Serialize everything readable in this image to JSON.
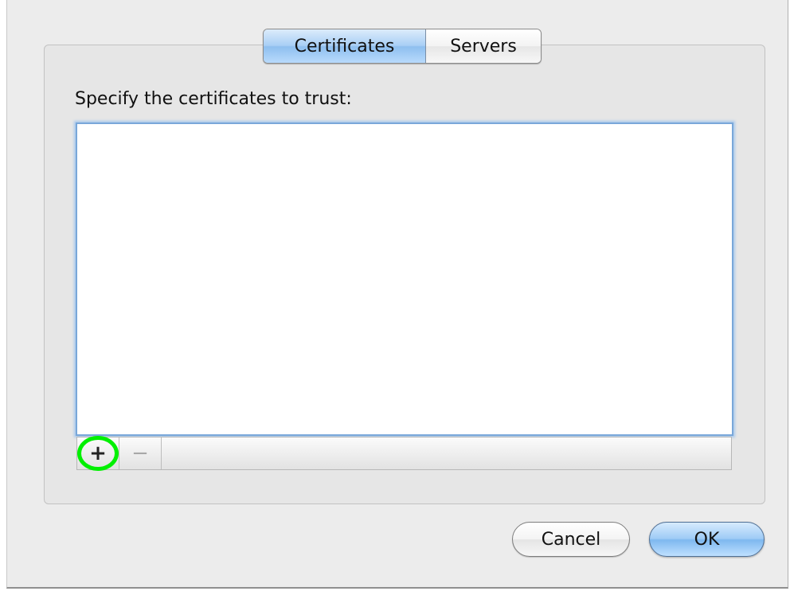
{
  "tabs": [
    {
      "label": "Certificates",
      "selected": true
    },
    {
      "label": "Servers",
      "selected": false
    }
  ],
  "main": {
    "instruction": "Specify the certificates to trust:",
    "list_items": []
  },
  "list_footer": {
    "add_label": "+",
    "remove_label": "−"
  },
  "buttons": {
    "cancel_label": "Cancel",
    "ok_label": "OK"
  },
  "colors": {
    "accent_blue": "#8fbfef",
    "highlight_ring": "#00f000"
  }
}
